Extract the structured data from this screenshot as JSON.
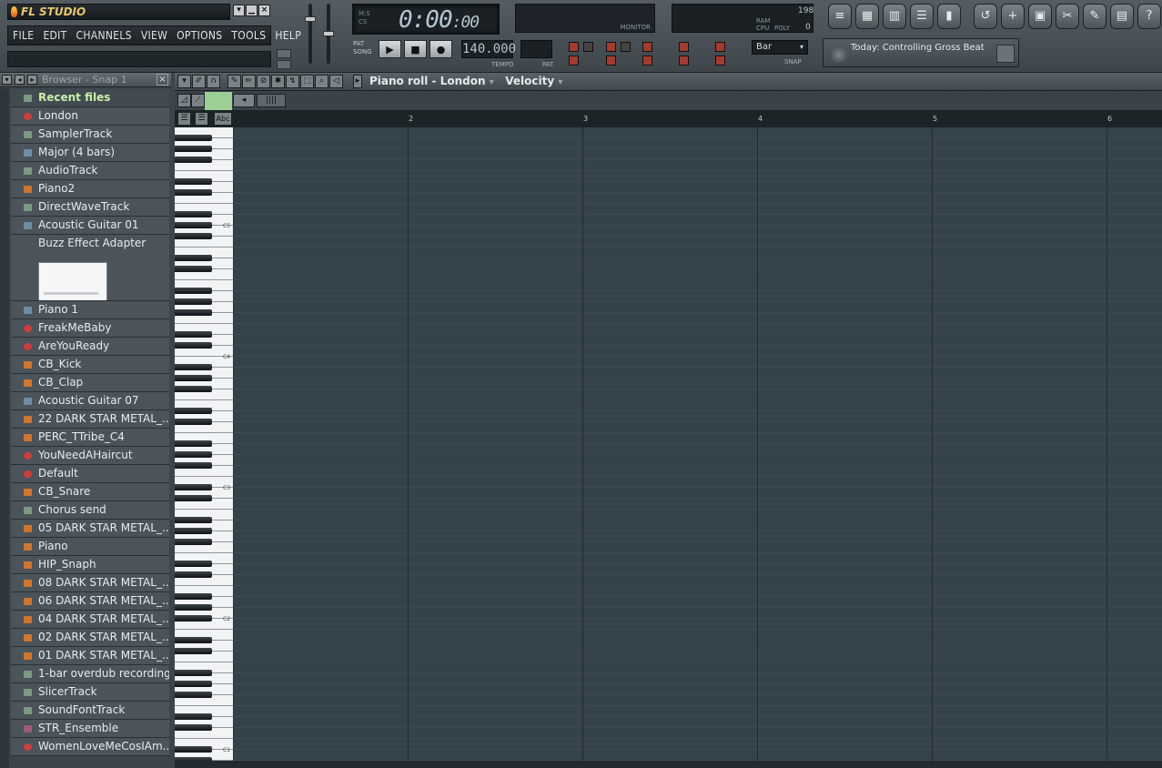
{
  "app": {
    "title": "FL STUDIO"
  },
  "menu": [
    "FILE",
    "EDIT",
    "CHANNELS",
    "VIEW",
    "OPTIONS",
    "TOOLS",
    "HELP"
  ],
  "transport": {
    "time": "0:00",
    "time_sub": ":00",
    "pat_label": "PAT",
    "song_label": "SONG",
    "tempo": "140.000",
    "tempo_label": "TEMPO",
    "pat_short": "PAT",
    "monitor_label": "MONITOR",
    "cpu_label": "CPU",
    "poly_label": "POLY",
    "ram_label": "RAM",
    "cpu_value": "198",
    "poly_value": "0"
  },
  "snap": {
    "value": "Bar",
    "label": "SNAP"
  },
  "hint": {
    "text": "Today: Controlling Gross Beat"
  },
  "browser": {
    "title": "Browser - Snap 1",
    "items": [
      {
        "label": "Recent files",
        "icon": "folder-icon",
        "head": true
      },
      {
        "label": "London",
        "icon": "red"
      },
      {
        "label": "SamplerTrack",
        "icon": "green"
      },
      {
        "label": "Major (4 bars)",
        "icon": "blue"
      },
      {
        "label": "AudioTrack",
        "icon": "green"
      },
      {
        "label": "Piano2",
        "icon": "orange"
      },
      {
        "label": "DirectWaveTrack",
        "icon": "green"
      },
      {
        "label": "Acoustic Guitar 01",
        "icon": "blue"
      },
      {
        "label": "Buzz Effect Adapter",
        "icon": "none",
        "tall": true
      },
      {
        "label": "Piano 1",
        "icon": "blue"
      },
      {
        "label": "FreakMeBaby",
        "icon": "red"
      },
      {
        "label": "AreYouReady",
        "icon": "red"
      },
      {
        "label": "CB_Kick",
        "icon": "orange"
      },
      {
        "label": "CB_Clap",
        "icon": "orange"
      },
      {
        "label": "Acoustic Guitar 07",
        "icon": "blue"
      },
      {
        "label": "22 DARK STAR METAL_...",
        "icon": "orange"
      },
      {
        "label": "PERC_TTribe_C4",
        "icon": "orange"
      },
      {
        "label": "YouNeedAHaircut",
        "icon": "red"
      },
      {
        "label": "Default",
        "icon": "red"
      },
      {
        "label": "CB_Snare",
        "icon": "orange"
      },
      {
        "label": "Chorus send",
        "icon": "green"
      },
      {
        "label": "05 DARK STAR METAL_...",
        "icon": "orange"
      },
      {
        "label": "Piano",
        "icon": "orange"
      },
      {
        "label": "HIP_Snaph",
        "icon": "orange"
      },
      {
        "label": "08 DARK STAR METAL_...",
        "icon": "orange"
      },
      {
        "label": "06 DARK STAR METAL_...",
        "icon": "orange"
      },
      {
        "label": "04 DARK STAR METAL_...",
        "icon": "orange"
      },
      {
        "label": "02 DARK STAR METAL_...",
        "icon": "orange"
      },
      {
        "label": "01 DARK STAR METAL_...",
        "icon": "orange"
      },
      {
        "label": "1-bar overdub recording",
        "icon": "green"
      },
      {
        "label": "SlicerTrack",
        "icon": "green"
      },
      {
        "label": "SoundFontTrack",
        "icon": "green"
      },
      {
        "label": "STR_Ensemble",
        "icon": "purple"
      },
      {
        "label": "WomenLoveMeCosIAm...",
        "icon": "red"
      }
    ]
  },
  "pianoroll": {
    "title": "Piano roll - London",
    "param": "Velocity",
    "text_tool": "Abc",
    "bars": [
      "2",
      "3",
      "4",
      "5",
      "6"
    ],
    "octaves": [
      "C5",
      "C4",
      "C3",
      "C2",
      "C1"
    ]
  },
  "colors": {
    "grid": "#34434b",
    "accent": "#9ccf94",
    "recent": "#c9f0a8"
  }
}
